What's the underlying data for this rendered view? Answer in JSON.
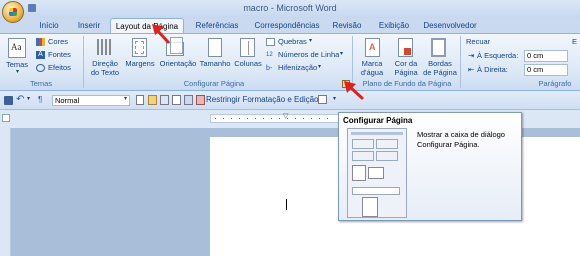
{
  "window": {
    "title": "macro - Microsoft Word"
  },
  "tabs": [
    {
      "label": "Início"
    },
    {
      "label": "Inserir"
    },
    {
      "label": "Layout da Página"
    },
    {
      "label": "Referências"
    },
    {
      "label": "Correspondências"
    },
    {
      "label": "Revisão"
    },
    {
      "label": "Exibição"
    },
    {
      "label": "Desenvolvedor"
    }
  ],
  "ribbon": {
    "temas": {
      "group_label": "Temas",
      "temas_btn": "Temas",
      "cores": "Cores",
      "fontes": "Fontes",
      "efeitos": "Efeitos"
    },
    "configurar": {
      "group_label": "Configurar Página",
      "direcao": [
        "Direção",
        "do Texto"
      ],
      "margens": "Margens",
      "orientacao": "Orientação",
      "tamanho": "Tamanho",
      "colunas": "Colunas",
      "quebras": "Quebras",
      "numeros": "Números de Linha",
      "hifenizacao": "Hifenização"
    },
    "fundo": {
      "group_label": "Plano de Fundo da Página",
      "marca": [
        "Marca",
        "d'água"
      ],
      "cor": [
        "Cor da",
        "Página"
      ],
      "bordas": [
        "Bordas",
        "de Página"
      ]
    },
    "paragrafo": {
      "group_label": "Parágrafo",
      "recuar": "Recuar",
      "esquerda_label": "À Esquerda:",
      "esquerda_value": "0 cm",
      "direita_label": "À Direita:",
      "direita_value": "0 cm",
      "espac": "E"
    }
  },
  "qat": {
    "style_value": "Normal",
    "restrict": "Restringir Formatação e Edição"
  },
  "tooltip": {
    "title": "Configurar Página",
    "text": "Mostrar a caixa de diálogo Configurar Página."
  },
  "colors": {
    "ribbon_text": "#15428b",
    "arrow": "#e0211b"
  }
}
